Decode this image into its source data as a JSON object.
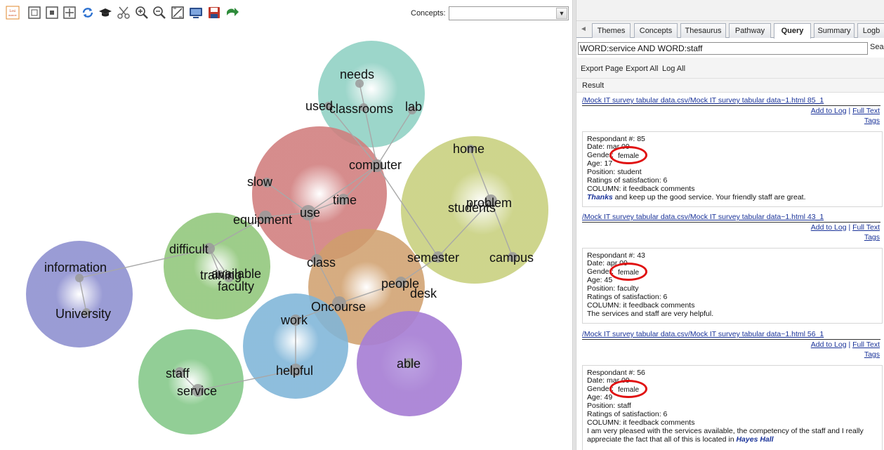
{
  "toolbar": {
    "buttons": [
      {
        "name": "leximancer-logo-icon",
        "color": "#e08a2c"
      },
      {
        "name": "fit-page-icon",
        "color": "#555"
      },
      {
        "name": "fit-window-icon",
        "color": "#555"
      },
      {
        "name": "center-icon",
        "color": "#555"
      },
      {
        "name": "refresh-icon",
        "color": "#2a6fcf"
      },
      {
        "name": "graduation-cap-icon",
        "color": "#222"
      },
      {
        "name": "scissors-icon",
        "color": "#666"
      },
      {
        "name": "zoom-in-icon",
        "color": "#444"
      },
      {
        "name": "zoom-out-icon",
        "color": "#444"
      },
      {
        "name": "chart-icon",
        "color": "#444"
      },
      {
        "name": "monitor-icon",
        "color": "#2b4e8c"
      },
      {
        "name": "save-icon",
        "color": "#c0392b"
      },
      {
        "name": "forward-arrow-icon",
        "color": "#2e8b3a"
      }
    ],
    "concepts_label": "Concepts:",
    "concepts_value": ""
  },
  "concept_map": {
    "themes": [
      {
        "color": "#8fd0c3"
      },
      {
        "color": "#d07d7d"
      },
      {
        "color": "#c7cf7d"
      },
      {
        "color": "#90c67a"
      },
      {
        "color": "#8f91d0"
      },
      {
        "color": "#cf9e6b"
      },
      {
        "color": "#7fb5d8"
      },
      {
        "color": "#a77fd4"
      },
      {
        "color": "#86c98a"
      }
    ],
    "concepts": [
      "needs",
      "used",
      "classrooms",
      "lab",
      "computer",
      "slow",
      "time",
      "use",
      "equipment",
      "home",
      "students",
      "problem",
      "campus",
      "semester",
      "difficult",
      "information",
      "training",
      "available",
      "faculty",
      "University",
      "class",
      "people",
      "desk",
      "Oncourse",
      "work",
      "helpful",
      "able",
      "staff",
      "service"
    ]
  },
  "panel": {
    "tabs": [
      "Themes",
      "Concepts",
      "Thesaurus",
      "Pathway",
      "Query",
      "Summary",
      "Logb"
    ],
    "active_tab": "Query",
    "query_value": "WORD:service AND WORD:staff",
    "search_label": "Sea",
    "export_page": "Export Page",
    "export_all": "Export All",
    "log_all": "Log All",
    "result_header": "Result",
    "add_to_log": "Add to Log",
    "separator": " | ",
    "full_text": "Full Text",
    "tags": "Tags",
    "highlight_color": "#e01010"
  },
  "results": [
    {
      "link": "/Mock IT survey tabular data.csv/Mock IT survey tabular data~1.html 85_1",
      "respondent": "Respondant #: 85",
      "date": "Date: mar 09",
      "gender_label": "Gender:",
      "gender": "female",
      "age": "Age: 17",
      "position": "Position: student",
      "ratings": "Ratings of satisfaction: 6",
      "column": "COLUMN: it feedback comments",
      "comment_highlight": "Thanks",
      "comment": " and keep up the good service. Your friendly staff are great."
    },
    {
      "link": "/Mock IT survey tabular data.csv/Mock IT survey tabular data~1.html 43_1",
      "respondent": "Respondant #: 43",
      "date": "Date: apr 09",
      "gender_label": "Gender:",
      "gender": "female",
      "age": "Age: 45",
      "position": "Position: faculty",
      "ratings": "Ratings of satisfaction: 6",
      "column": "COLUMN: it feedback comments",
      "comment": "The services and staff are very helpful."
    },
    {
      "link": "/Mock IT survey tabular data.csv/Mock IT survey tabular data~1.html 56_1",
      "respondent": "Respondant #: 56",
      "date": "Date: mar 09",
      "gender_label": "Gender:",
      "gender": "female",
      "age": "Age: 49",
      "position": "Position: staff",
      "ratings": "Ratings of satisfaction: 6",
      "column": "COLUMN: it feedback comments",
      "comment": "I am very pleased with the services available, the competency of the staff and I really",
      "comment2_prefix": "appreciate the fact that all of this is located in ",
      "comment2_highlight": "Hayes Hall"
    }
  ]
}
